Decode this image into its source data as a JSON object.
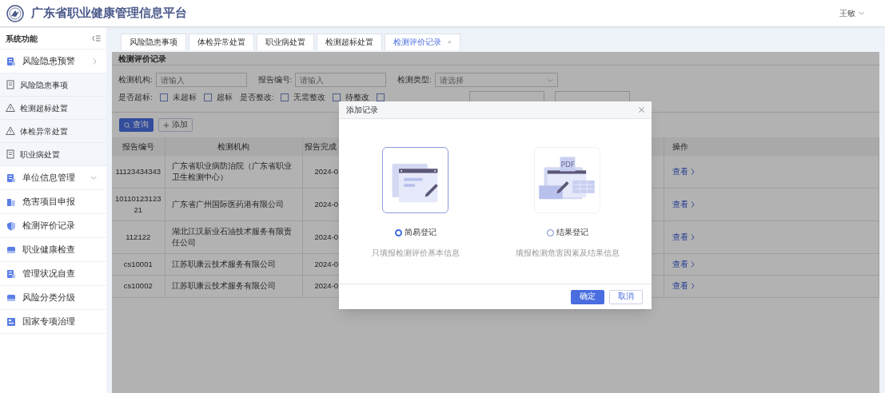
{
  "header": {
    "title": "广东省职业健康管理信息平台",
    "user": "王敏"
  },
  "sidebar": {
    "title": "系统功能",
    "items": [
      {
        "label": "风险隐患预警",
        "kind": "stack",
        "expanded": false,
        "children": [
          {
            "label": "风险隐患事项",
            "kind": "doc"
          },
          {
            "label": "检测超标处置",
            "kind": "warning"
          },
          {
            "label": "体检异常处置",
            "kind": "warning"
          },
          {
            "label": "职业病处置",
            "kind": "doc"
          }
        ]
      },
      {
        "label": "单位信息管理",
        "kind": "stack",
        "expanded": true
      },
      {
        "label": "危害项目申报",
        "kind": "building"
      },
      {
        "label": "检测评价记录",
        "kind": "shield"
      },
      {
        "label": "职业健康检查",
        "kind": "tray"
      },
      {
        "label": "管理状况自查",
        "kind": "stack"
      },
      {
        "label": "风险分类分级",
        "kind": "tray"
      },
      {
        "label": "国家专项治理",
        "kind": "board"
      }
    ]
  },
  "tabs": [
    {
      "label": "风险隐患事项",
      "selected": false
    },
    {
      "label": "体检异常处置",
      "selected": false
    },
    {
      "label": "职业病处置",
      "selected": false
    },
    {
      "label": "检测超标处置",
      "selected": false
    },
    {
      "label": "检测评价记录",
      "selected": true,
      "close": "×"
    }
  ],
  "panel": {
    "title": "检测评价记录",
    "fields": [
      {
        "label": "检测机构:",
        "placeholder": "请输入",
        "kind": "input"
      },
      {
        "label": "报告编号:",
        "placeholder": "请输入",
        "kind": "input"
      },
      {
        "label": "检测类型:",
        "placeholder": "请选择",
        "kind": "select"
      }
    ],
    "checkbox_groups": [
      {
        "label": "是否超标:",
        "options": [
          {
            "label": "未超标",
            "checked": false
          },
          {
            "label": "超标",
            "checked": false
          }
        ]
      },
      {
        "label": "是否整改:",
        "options": [
          {
            "label": "无需整改",
            "checked": false
          },
          {
            "label": "待整改",
            "checked": false
          },
          {
            "checked": false
          }
        ]
      }
    ],
    "buttons": [
      {
        "label": "查询",
        "kind": "primary"
      },
      {
        "label": "添加",
        "kind": "add"
      }
    ],
    "table": {
      "columns": [
        "报告编号",
        "检测机构",
        "报告完成",
        "操作"
      ],
      "rows": [
        {
          "cells": [
            "11123434343",
            "广东省职业病防治院（广东省职业卫生检测中心）",
            "2024-0",
            "查看"
          ]
        },
        {
          "cells": [
            "1011012312321",
            "广东省广州国际医药港有限公司",
            "2024-0",
            "查看"
          ]
        },
        {
          "cells": [
            "112122",
            "湖北江汉新业石油技术服务有限责任公司",
            "2024-0",
            "查看"
          ]
        },
        {
          "cells": [
            "cs10001",
            "江苏职康云技术服务有限公司",
            "2024-0",
            "查看"
          ]
        },
        {
          "cells": [
            "cs10002",
            "江苏职康云技术服务有限公司",
            "2024-0",
            "查看"
          ]
        }
      ]
    }
  },
  "modal": {
    "title": "添加记录",
    "options": [
      {
        "label": "简易登记",
        "description": "只填报检测评价基本信息",
        "selected": true,
        "kind": "simple"
      },
      {
        "label": "结果登记",
        "description": "填报检测危害因素及结果信息",
        "selected": false,
        "kind": "result",
        "badge": "PDF"
      }
    ],
    "buttons": [
      {
        "label": "确定",
        "kind": "primary"
      },
      {
        "label": "取消",
        "kind": "default"
      }
    ]
  }
}
